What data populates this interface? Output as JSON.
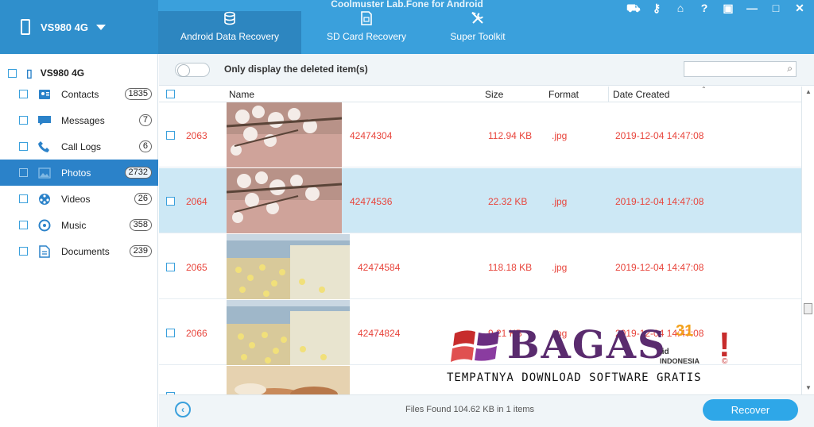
{
  "window": {
    "title": "Coolmuster Lab.Fone for Android"
  },
  "device": {
    "name": "VS980 4G"
  },
  "tabs": [
    {
      "label": "Android Data Recovery",
      "icon": "database-icon"
    },
    {
      "label": "SD Card Recovery",
      "icon": "sd-card-icon"
    },
    {
      "label": "Super Toolkit",
      "icon": "tools-icon"
    }
  ],
  "sidebar": {
    "root": "VS980 4G",
    "items": [
      {
        "label": "Contacts",
        "count": "1835",
        "icon": "contacts-icon"
      },
      {
        "label": "Messages",
        "count": "7",
        "icon": "messages-icon"
      },
      {
        "label": "Call Logs",
        "count": "6",
        "icon": "phone-icon"
      },
      {
        "label": "Photos",
        "count": "2732",
        "icon": "photos-icon"
      },
      {
        "label": "Videos",
        "count": "26",
        "icon": "videos-icon"
      },
      {
        "label": "Music",
        "count": "358",
        "icon": "music-icon"
      },
      {
        "label": "Documents",
        "count": "239",
        "icon": "documents-icon"
      }
    ]
  },
  "filter": {
    "label": "Only display the deleted item(s)",
    "search_placeholder": ""
  },
  "columns": {
    "name": "Name",
    "size": "Size",
    "format": "Format",
    "date": "Date Created"
  },
  "rows": [
    {
      "id": "2063",
      "name": "42474304",
      "size": "112.94 KB",
      "format": ".jpg",
      "date": "2019-12-04 14:47:08"
    },
    {
      "id": "2064",
      "name": "42474536",
      "size": "22.32 KB",
      "format": ".jpg",
      "date": "2019-12-04 14:47:08"
    },
    {
      "id": "2065",
      "name": "42474584",
      "size": "118.18 KB",
      "format": ".jpg",
      "date": "2019-12-04 14:47:08"
    },
    {
      "id": "2066",
      "name": "42474824",
      "size": "9.21 KB",
      "format": ".jpg",
      "date": "2019-12-04 14:47:08"
    }
  ],
  "footer": {
    "status": "Files Found 104.62 KB in 1 items",
    "recover_label": "Recover"
  },
  "watermark": {
    "brand": "BAGAS",
    "superscript": "31",
    "domain": ".id",
    "country": "INDONESIA",
    "tagline": "TEMPATNYA DOWNLOAD SOFTWARE GRATIS"
  },
  "colors": {
    "header": "#3aa0dc",
    "active_tab": "#2d86c0",
    "selected_sidebar": "#2b82c9",
    "row_text": "#e8453c",
    "selected_row": "#cde8f5",
    "recover_button": "#2ea7e8"
  }
}
